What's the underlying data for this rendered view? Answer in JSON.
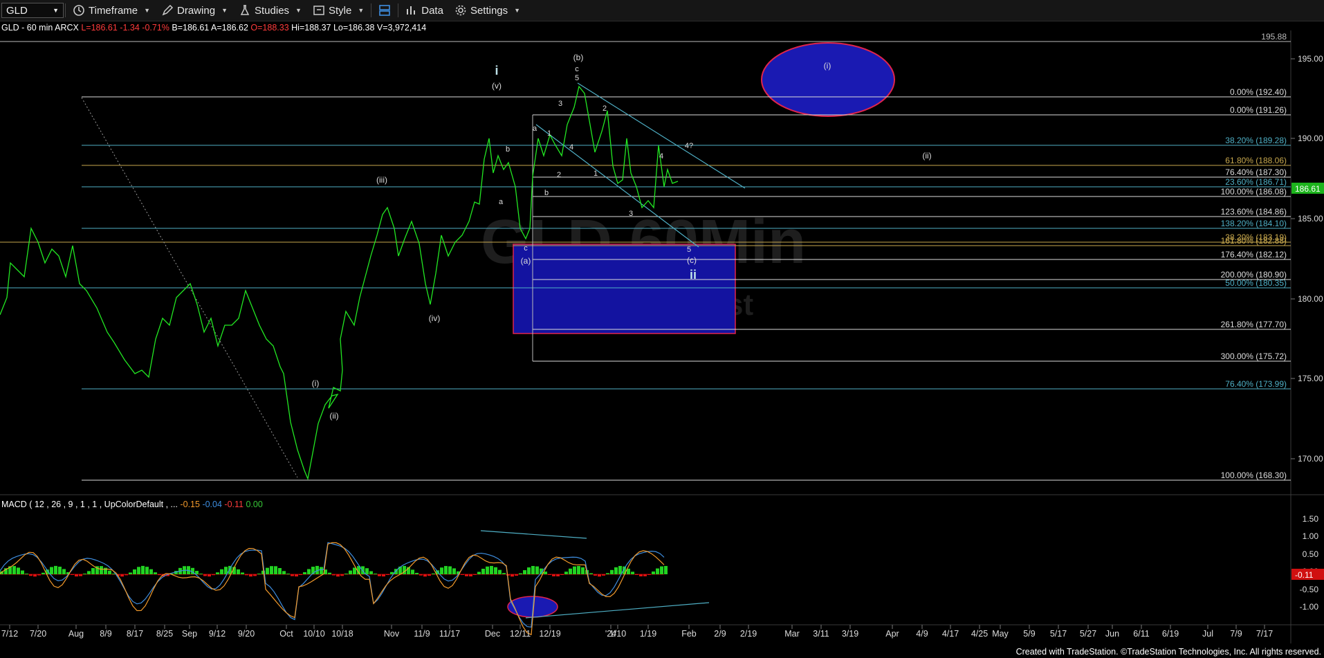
{
  "toolbar": {
    "symbol": "GLD",
    "timeframe": "Timeframe",
    "drawing": "Drawing",
    "studies": "Studies",
    "style": "Style",
    "data": "Data",
    "settings": "Settings"
  },
  "quote": {
    "name": "GLD - 60 min  ARCX",
    "last": "L=186.61",
    "change": "-1.34",
    "pct": "-0.71%",
    "bid": "B=186.61",
    "ask": "A=186.62",
    "open": "O=188.33",
    "high": "Hi=188.37",
    "low": "Lo=186.38",
    "volume": "V=3,972,414"
  },
  "macd_label": {
    "text": "MACD ( 12 , 26 , 9 , 1 , 1 , UpColorDefault , ...",
    "v1": "-0.15",
    "v2": "-0.04",
    "v3": "-0.11",
    "v4": "0.00"
  },
  "price_axis": {
    "ticks": [
      "195.00",
      "190.00",
      "185.00",
      "180.00",
      "175.00",
      "170.00"
    ],
    "last_price": "186.61",
    "last_color": "#1db41d"
  },
  "macd_axis": {
    "ticks": [
      "1.50",
      "1.00",
      "0.50",
      "0.00",
      "-0.50",
      "-1.00"
    ],
    "current": "-0.11"
  },
  "time_axis": [
    "7/12",
    "7/20",
    "Aug",
    "8/9",
    "8/17",
    "8/25",
    "Sep",
    "9/12",
    "9/20",
    "Oct",
    "10/10",
    "10/18",
    "Nov",
    "11/9",
    "11/17",
    "Dec",
    "12/11",
    "12/19",
    "'24",
    "1/10",
    "1/19",
    "Feb",
    "2/9",
    "2/19",
    "Mar",
    "3/11",
    "3/19",
    "Apr",
    "4/9",
    "4/17",
    "4/25",
    "May",
    "5/9",
    "5/17",
    "5/27",
    "Jun",
    "6/11",
    "6/19",
    "Jul",
    "7/9",
    "7/17"
  ],
  "fib_labels": [
    {
      "text": "195.88",
      "color": "#bbbbbb"
    },
    {
      "text": "0.00% (192.40)",
      "color": "#dddddd"
    },
    {
      "text": "0.00% (191.26)",
      "color": "#dddddd"
    },
    {
      "text": "38.20% (189.28)",
      "color": "#4fb0c6"
    },
    {
      "text": "61.80% (188.06)",
      "color": "#c9a94e"
    },
    {
      "text": "76.40% (187.30)",
      "color": "#dddddd"
    },
    {
      "text": "23.60% (186.71)",
      "color": "#4fb0c6"
    },
    {
      "text": "100.00% (186.08)",
      "color": "#dddddd"
    },
    {
      "text": "123.60% (184.86)",
      "color": "#dddddd"
    },
    {
      "text": "138.20% (184.10)",
      "color": "#4fb0c6"
    },
    {
      "text": "38.20% (183.19)",
      "color": "#c9a94e"
    },
    {
      "text": "161.80% (182.88)",
      "color": "#c9a94e"
    },
    {
      "text": "176.40% (182.12)",
      "color": "#dddddd"
    },
    {
      "text": "200.00% (180.90)",
      "color": "#dddddd"
    },
    {
      "text": "50.00% (180.35)",
      "color": "#4fb0c6"
    },
    {
      "text": "261.80% (177.70)",
      "color": "#dddddd"
    },
    {
      "text": "300.00% (175.72)",
      "color": "#dddddd"
    },
    {
      "text": "76.40% (173.99)",
      "color": "#4fb0c6"
    },
    {
      "text": "100.00% (168.30)",
      "color": "#dddddd"
    }
  ],
  "wave_labels": [
    "i",
    "(v)",
    "(iii)",
    "(iv)",
    "(i)",
    "(ii)",
    "(b)",
    "c",
    "5",
    "3",
    "2",
    "a",
    "1",
    "4",
    "1",
    "2",
    "b",
    "b",
    "a",
    "c",
    "(a)",
    "3",
    "4",
    "4?",
    "5",
    "(c)",
    "ii",
    "(i)",
    "(ii)"
  ],
  "watermark": "GLD 60Min",
  "footer": "Created with TradeStation. ©TradeStation Technologies, Inc. All rights reserved."
}
